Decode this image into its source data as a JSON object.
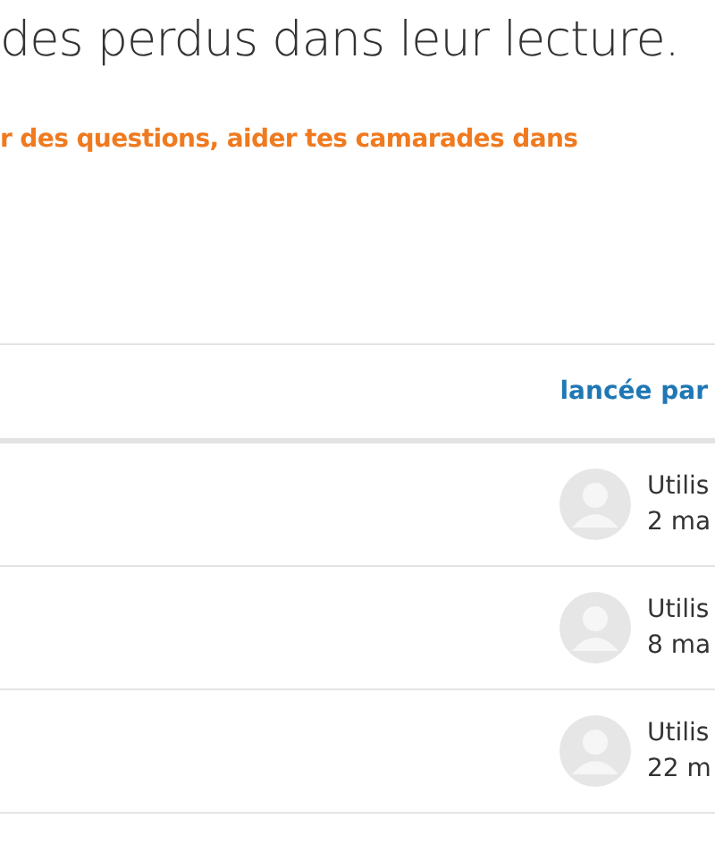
{
  "intro": {
    "text": "des perdus dans leur lecture.",
    "note": "r des questions, aider tes camarades dans"
  },
  "table": {
    "columns": [
      {
        "label": "lancée par"
      }
    ],
    "rows": [
      {
        "author": "Utilis",
        "date": "2 ma"
      },
      {
        "author": "Utilis",
        "date": "8 ma"
      },
      {
        "author": "Utilis",
        "date": "22 m"
      }
    ]
  }
}
